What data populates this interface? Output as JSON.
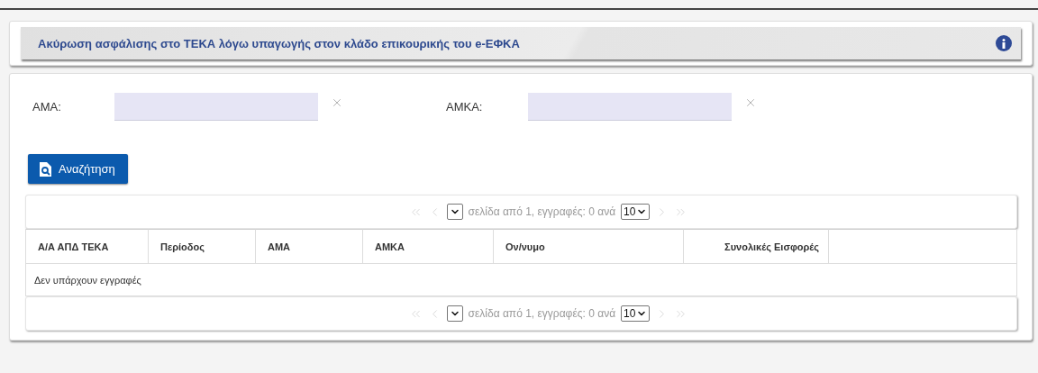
{
  "header": {
    "title": "Ακύρωση ασφάλισης στο ΤΕΚΑ λόγω υπαγωγής στον κλάδο επικουρικής του e-ΕΦΚΑ"
  },
  "filters": [
    {
      "label": "ΑΜΑ:"
    },
    {
      "label": "ΑΜΚΑ:"
    }
  ],
  "search_button": {
    "label": "Αναζήτηση"
  },
  "pagers": [
    {
      "nav_disabled": true,
      "summary": "σελίδα από 1, εγγραφές: 0 ανά",
      "page_size": "10"
    },
    {
      "nav_disabled": true,
      "summary": "σελίδα από 1, εγγραφές: 0 ανά",
      "page_size": "10"
    }
  ],
  "table": {
    "columns": [
      {
        "label": "Α/Α ΑΠΔ ΤΕΚΑ",
        "kind": "text"
      },
      {
        "label": "Περίοδος",
        "kind": "text"
      },
      {
        "label": "ΑΜΑ",
        "kind": "text"
      },
      {
        "label": "ΑΜΚΑ",
        "kind": "text"
      },
      {
        "label": "Ον/νυμο",
        "kind": "text"
      },
      {
        "label": "Συνολικές Εισφορές",
        "kind": "number"
      }
    ],
    "empty_message": "Δεν υπάρχουν εγγραφές"
  }
}
